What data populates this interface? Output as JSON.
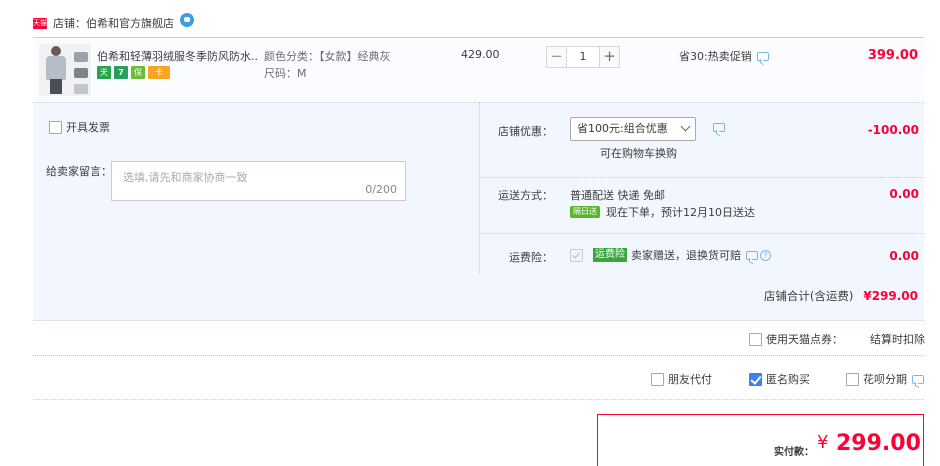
{
  "store": {
    "badge": "天猫",
    "name": "店铺：伯希和官方旗舰店"
  },
  "item": {
    "title": "伯希和轻薄羽绒服冬季防风防水...",
    "badges": [
      "天猫",
      "7",
      "保",
      "卡"
    ],
    "sku_color": "颜色分类：【女款】经典灰",
    "sku_size": "尺码：M",
    "unit_price": "429.00",
    "quantity": "1",
    "qty_minus": "−",
    "qty_plus": "+",
    "promo": "省30:热卖促销",
    "subtotal": "399.00"
  },
  "invoice": {
    "label": "开具发票"
  },
  "note": {
    "label": "给卖家留言：",
    "placeholder": "选填,请先和商家协商一致",
    "counter": "0/200"
  },
  "store_discount": {
    "label": "店铺优惠：",
    "selected": "省100元:组合优惠",
    "note": "可在购物车换购",
    "amount": "-100.00"
  },
  "shipping": {
    "label": "运送方式：",
    "method": "普通配送 快递 免邮",
    "tag": "隔日送",
    "eta": "现在下单，预计12月10日送达",
    "amount": "0.00"
  },
  "insurance": {
    "label": "运费险：",
    "tag": "运费险",
    "text": "卖家赠送，退换货可赔",
    "amount": "0.00"
  },
  "store_total": {
    "label": "店铺合计(含运费)",
    "value": "¥299.00"
  },
  "coupon": {
    "label": "使用天猫点券：",
    "deduct": "结算时扣除"
  },
  "options": {
    "friend_pay": "朋友代付",
    "anonymous": "匿名购买",
    "huabei": "花呗分期"
  },
  "payment": {
    "label": "实付款：",
    "currency": "¥",
    "value": "299.00"
  },
  "colors": {
    "accent": "#ff0036",
    "panel": "#f2f7ff",
    "border": "#b2d1ff",
    "check": "#3d82f1"
  }
}
